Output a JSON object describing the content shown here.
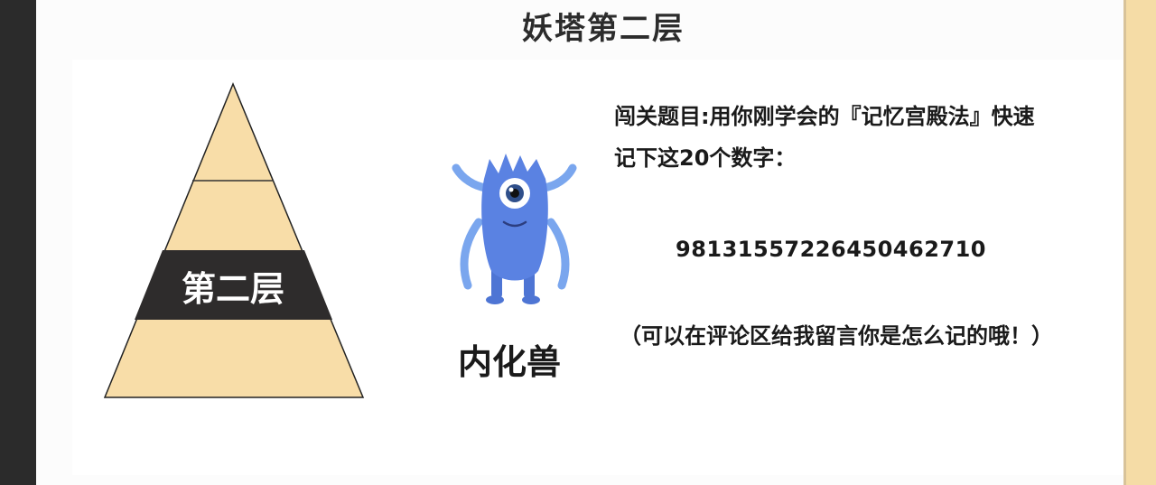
{
  "slide": {
    "title": "妖塔第二层"
  },
  "pyramid": {
    "highlight_label": "第二层",
    "colors": {
      "fill": "#f8dda8",
      "band": "#2e2c2c",
      "outline": "#222222"
    }
  },
  "monster": {
    "name": "内化兽",
    "icon": "blue-monster-icon",
    "colors": {
      "body": "#5a82e2",
      "arms": "#7aa6ee"
    }
  },
  "challenge": {
    "question_line1": "闯关题目:用你刚学会的『记忆宫殿法』快速",
    "question_line2": "记下这20个数字：",
    "digits": "98131557226450462710",
    "note": "（可以在评论区给我留言你是怎么记的哦！）"
  }
}
